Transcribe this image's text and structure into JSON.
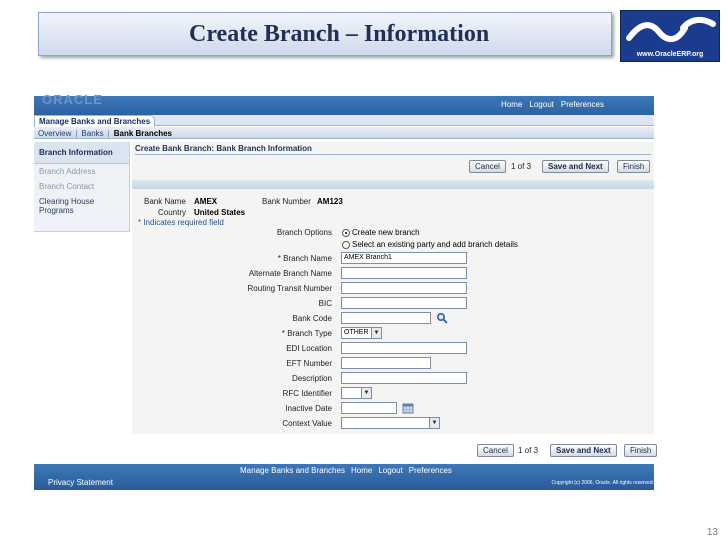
{
  "slide": {
    "title": "Create Branch – Information",
    "logo_text": "www.OracleERP.org",
    "number": "13"
  },
  "banner": {
    "faded_text": "ORACLE",
    "links": [
      "Home",
      "Logout",
      "Preferences"
    ]
  },
  "tabs": {
    "active": "Manage Banks and Branches"
  },
  "subnav": {
    "items": [
      "Overview",
      "Banks",
      "Bank Branches"
    ],
    "separator": "|"
  },
  "side_nav": {
    "items": [
      "Branch Information",
      "Branch Address",
      "Branch Contact",
      "Clearing House Programs"
    ]
  },
  "page": {
    "heading": "Create Bank Branch: Bank Branch Information",
    "cancel_label": "Cancel",
    "page_count": "1 of 3",
    "save_next_label": "Save and Next",
    "finish_label": "Finish"
  },
  "bank_info": {
    "bank_name_label": "Bank Name",
    "bank_name": "AMEX",
    "bank_number_label": "Bank Number",
    "bank_number": "AM123",
    "country_label": "Country",
    "country": "United States",
    "required_note": "* Indicates required field"
  },
  "form": {
    "branch_options_label": "Branch Options",
    "option_create": "Create new branch",
    "option_select": "Select an existing party and add branch details",
    "branch_name_label": "* Branch Name",
    "branch_name_value": "AMEX Branch1",
    "alternate_branch_name_label": "Alternate Branch Name",
    "routing_transit_number_label": "Routing Transit Number",
    "bic_label": "BIC",
    "bank_code_label": "Bank Code",
    "branch_type_label": "* Branch Type",
    "branch_type_value": "OTHER",
    "edi_location_label": "EDI Location",
    "eft_number_label": "EFT Number",
    "description_label": "Description",
    "rfc_identifier_label": "RFC Identifier",
    "inactive_date_label": "Inactive Date",
    "context_value_label": "Context Value"
  },
  "footer": {
    "links": [
      "Manage Banks and Branches",
      "Home",
      "Logout",
      "Preferences"
    ],
    "privacy": "Privacy Statement",
    "copyright": "Copyright (c) 2006, Oracle. All rights reserved."
  },
  "colors": {
    "banner": "#2d62a4",
    "title": "#1f2f56",
    "logo_bg": "#1b3c8d"
  }
}
